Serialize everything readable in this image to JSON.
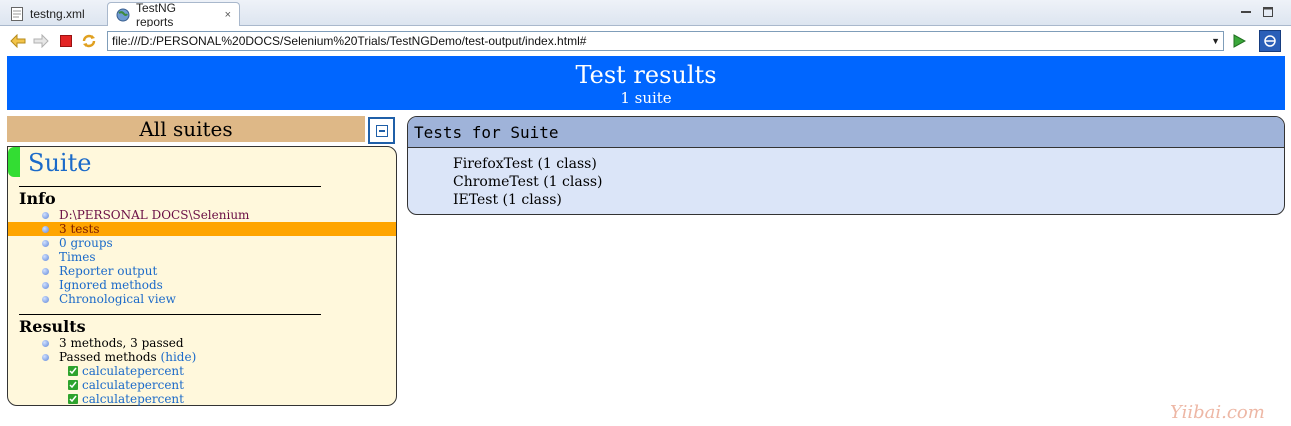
{
  "tabs": [
    {
      "label": "testng.xml",
      "icon": "xml-file-icon"
    },
    {
      "label": "TestNG reports",
      "icon": "globe-icon",
      "close": "×"
    }
  ],
  "toolbar": {
    "url": "file:///D:/PERSONAL%20DOCS/Selenium%20Trials/TestNGDemo/test-output/index.html#"
  },
  "banner": {
    "title": "Test results",
    "subtitle": "1 suite"
  },
  "left": {
    "header": "All suites",
    "suite_name": "Suite",
    "info_heading": "Info",
    "info_items": [
      "D:\\PERSONAL DOCS\\Selenium Trials\\TestNGDemo\\testng.xml",
      "3 tests",
      "0 groups",
      "Times",
      "Reporter output",
      "Ignored methods",
      "Chronological view"
    ],
    "results_heading": "Results",
    "summary": "3 methods, 3 passed",
    "passed_label": "Passed methods",
    "hide_label": "(hide)",
    "methods": [
      "calculatepercent",
      "calculatepercent",
      "calculatepercent"
    ]
  },
  "right": {
    "header": "Tests for Suite",
    "tests": [
      "FirefoxTest (1 class)",
      "ChromeTest (1 class)",
      "IETest (1 class)"
    ]
  },
  "watermark": "Yiibai.com",
  "colors": {
    "banner": "#0066ff",
    "suites_header": "#deb887",
    "suite_bg": "#fff8dc",
    "highlight": "#ffa500",
    "tests_header": "#9fb3d9",
    "tests_bg": "#dbe5f8"
  }
}
